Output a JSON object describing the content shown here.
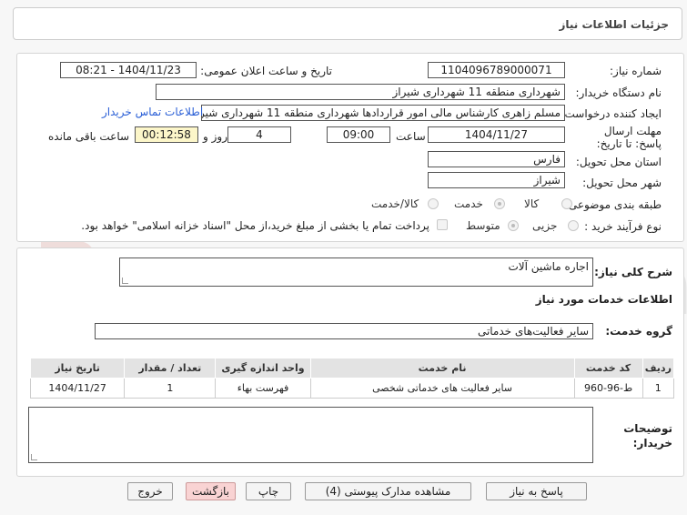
{
  "header": {
    "title": "جزئیات اطلاعات نیاز"
  },
  "form": {
    "need_number_label": "شماره نیاز:",
    "need_number": "1104096789000071",
    "announce_label": "تاریخ و ساعت اعلان عمومی:",
    "announce_value": "1404/11/23 - 08:21",
    "buyer_org_label": "نام دستگاه خریدار:",
    "buyer_org": "شهرداری منطقه 11 شهرداری شیراز",
    "requester_label": "ایجاد کننده درخواست:",
    "requester": "مسلم زاهری کارشناس مالی امور قراردادها شهرداری منطقه 11 شهرداری شیراز",
    "contact_link": "اطلاعات تماس خریدار",
    "deadline_label": "مهلت ارسال پاسخ: تا تاریخ:",
    "deadline_date": "1404/11/27",
    "time_label": "ساعت",
    "deadline_time": "09:00",
    "days_count": "4",
    "days_label": "روز و",
    "remaining_time": "00:12:58",
    "remaining_label": "ساعت باقی مانده",
    "province_label": "استان محل تحویل:",
    "province": "فارس",
    "city_label": "شهر محل تحویل:",
    "city": "شیراز",
    "category_label": "طبقه بندی موضوعی:",
    "category_options": [
      "کالا",
      "خدمت",
      "کالا/خدمت"
    ],
    "process_label": "نوع فرآیند خرید :",
    "process_options": [
      "جزیی",
      "متوسط"
    ],
    "payment_note": "پرداخت تمام یا بخشی از مبلغ خرید،از محل \"اسناد خزانه اسلامی\" خواهد بود."
  },
  "details": {
    "summary_label": "شرح کلی نیاز:",
    "summary": "اجاره ماشین آلات",
    "services_info_label": "اطلاعات خدمات مورد نیاز",
    "service_group_label": "گروه خدمت:",
    "service_group": "سایر فعالیت‌های خدماتی",
    "buyer_notes_label": "توضیحات خریدار:"
  },
  "table": {
    "headers": [
      "ردیف",
      "کد خدمت",
      "نام خدمت",
      "واحد اندازه گیری",
      "تعداد / مقدار",
      "تاریخ نیاز"
    ],
    "rows": [
      [
        "1",
        "ط-96-960",
        "سایر فعالیت های خدماتی شخصی",
        "فهرست بهاء",
        "1",
        "1404/11/27"
      ]
    ]
  },
  "buttons": {
    "reply": "پاسخ به نیاز",
    "attachments": "مشاهده مدارک پیوستی (4)",
    "print": "چاپ",
    "back": "بازگشت",
    "exit": "خروج"
  },
  "watermark": {
    "text": "AriaTender.net"
  },
  "colors": {
    "link": "#2a5fd6",
    "remaining_bg": "#fcf6c9",
    "exit_bg": "#f9d3d3"
  }
}
